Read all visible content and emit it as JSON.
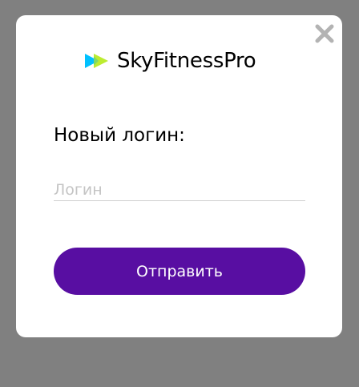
{
  "logo": {
    "text": "SkyFitnessPro",
    "icon": "play-arrows-icon",
    "colors": {
      "back_arrow": "#00c1ff",
      "front_arrow": "#bcec30"
    }
  },
  "form": {
    "title": "Новый логин:",
    "login_placeholder": "Логин",
    "login_value": "",
    "submit_label": "Отправить"
  },
  "close": {
    "icon": "close-icon"
  },
  "colors": {
    "overlay": "#808080",
    "accent": "#580ea2",
    "close_icon": "#b3b3b3"
  }
}
